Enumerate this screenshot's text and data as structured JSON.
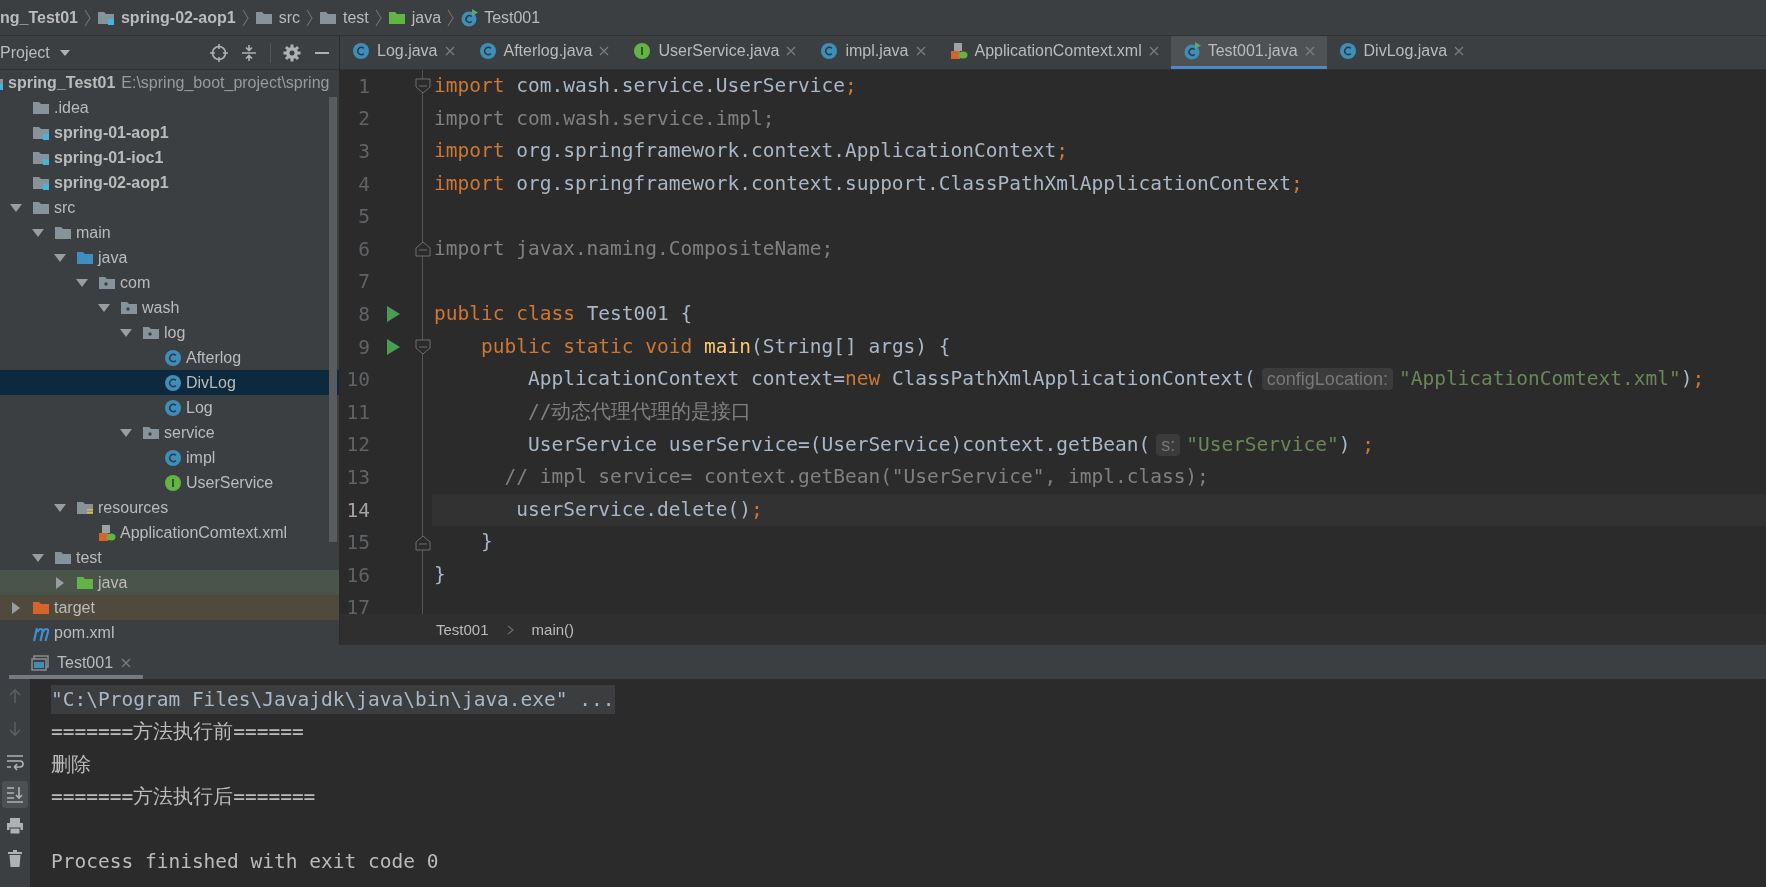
{
  "nav_bar": {
    "items": [
      {
        "kind": "project",
        "text": "ng_Test01"
      },
      {
        "kind": "module",
        "text": "spring-02-aop1"
      },
      {
        "kind": "folder",
        "text": "src"
      },
      {
        "kind": "folder",
        "text": "test"
      },
      {
        "kind": "test-source",
        "text": "java"
      },
      {
        "kind": "class-run",
        "text": "Test001"
      }
    ]
  },
  "project_panel": {
    "title": "Project",
    "tree": [
      {
        "name": "spring_Test01",
        "kind": "module",
        "path": "E:\\spring_boot_project\\spring",
        "selected": false,
        "children": [
          {
            "name": ".idea",
            "kind": "folder",
            "selected": false
          },
          {
            "name": "spring-01-aop1",
            "kind": "module",
            "selected": false
          },
          {
            "name": "spring-01-ioc1",
            "kind": "module",
            "selected": false
          },
          {
            "name": "spring-02-aop1",
            "kind": "module",
            "selected": false
          },
          {
            "name": "src",
            "kind": "folder",
            "expanded": true,
            "selected": false,
            "children": [
              {
                "name": "main",
                "kind": "folder",
                "expanded": true,
                "selected": false,
                "children": [
                  {
                    "name": "java",
                    "kind": "source",
                    "expanded": true,
                    "selected": false,
                    "children": [
                      {
                        "name": "com",
                        "kind": "package",
                        "expanded": true,
                        "selected": false,
                        "children": [
                          {
                            "name": "wash",
                            "kind": "package",
                            "expanded": true,
                            "selected": false,
                            "children": [
                              {
                                "name": "log",
                                "kind": "package",
                                "expanded": true,
                                "selected": false,
                                "children": [
                                  {
                                    "name": "Afterlog",
                                    "kind": "class",
                                    "selected": false
                                  },
                                  {
                                    "name": "DivLog",
                                    "kind": "class",
                                    "selected": true
                                  },
                                  {
                                    "name": "Log",
                                    "kind": "class",
                                    "selected": false
                                  }
                                ]
                              },
                              {
                                "name": "service",
                                "kind": "package",
                                "expanded": true,
                                "selected": false,
                                "children": [
                                  {
                                    "name": "impl",
                                    "kind": "class",
                                    "selected": false
                                  },
                                  {
                                    "name": "UserService",
                                    "kind": "interface",
                                    "selected": false
                                  }
                                ]
                              }
                            ]
                          }
                        ]
                      }
                    ]
                  },
                  {
                    "name": "resources",
                    "kind": "resources",
                    "expanded": true,
                    "selected": false,
                    "children": [
                      {
                        "name": "ApplicationComtext.xml",
                        "kind": "xml",
                        "selected": false
                      }
                    ]
                  }
                ]
              },
              {
                "name": "test",
                "kind": "folder",
                "expanded": true,
                "selected": false,
                "children": [
                  {
                    "name": "java",
                    "kind": "test-source",
                    "expanded": false,
                    "selected": false
                  }
                ]
              }
            ]
          },
          {
            "name": "target",
            "kind": "excluded",
            "expanded": false,
            "selected": false
          },
          {
            "name": "pom.xml",
            "kind": "maven",
            "selected": false
          }
        ]
      }
    ]
  },
  "editor": {
    "tabs": [
      {
        "label": "Log.java",
        "kind": "class",
        "selected": false
      },
      {
        "label": "Afterlog.java",
        "kind": "class",
        "selected": false
      },
      {
        "label": "UserService.java",
        "kind": "interface",
        "selected": false
      },
      {
        "label": "impl.java",
        "kind": "class",
        "selected": false
      },
      {
        "label": "ApplicationComtext.xml",
        "kind": "xml",
        "selected": false
      },
      {
        "label": "Test001.java",
        "kind": "class-run",
        "selected": true
      },
      {
        "label": "DivLog.java",
        "kind": "class",
        "selected": false
      }
    ],
    "lines": [
      {
        "number": "1",
        "run": false,
        "fold": {
          "kind": "start"
        },
        "current": false,
        "tokens": [
          {
            "kind": "keyword",
            "text": "import"
          },
          {
            "kind": "plain",
            "text": " com.wash.service.UserService"
          },
          {
            "kind": "semicolon",
            "text": ";"
          }
        ]
      },
      {
        "number": "2",
        "run": false,
        "current": false,
        "tokens": [
          {
            "kind": "unused",
            "text": "import com.wash.service.impl;"
          }
        ]
      },
      {
        "number": "3",
        "run": false,
        "current": false,
        "tokens": [
          {
            "kind": "keyword",
            "text": "import"
          },
          {
            "kind": "plain",
            "text": " org.springframework.context.ApplicationContext"
          },
          {
            "kind": "semicolon",
            "text": ";"
          }
        ]
      },
      {
        "number": "4",
        "run": false,
        "current": false,
        "tokens": [
          {
            "kind": "keyword",
            "text": "import"
          },
          {
            "kind": "plain",
            "text": " org.springframework.context.support.ClassPathXmlApplicationContext"
          },
          {
            "kind": "semicolon",
            "text": ";"
          }
        ]
      },
      {
        "number": "5",
        "run": false,
        "current": false
      },
      {
        "number": "6",
        "run": false,
        "fold": {
          "kind": "end"
        },
        "current": false,
        "tokens": [
          {
            "kind": "unused",
            "text": "import javax.naming.CompositeName;"
          }
        ]
      },
      {
        "number": "7",
        "run": false,
        "current": false
      },
      {
        "number": "8",
        "run": true,
        "current": false,
        "tokens": [
          {
            "kind": "keyword",
            "text": "public class"
          },
          {
            "kind": "plain",
            "text": " Test001 {"
          }
        ]
      },
      {
        "number": "9",
        "run": true,
        "fold": {
          "kind": "start"
        },
        "current": false,
        "tokens": [
          {
            "kind": "keyword",
            "text": "    public static void "
          },
          {
            "kind": "method",
            "text": "main"
          },
          {
            "kind": "plain",
            "text": "(String[] args) {"
          }
        ]
      },
      {
        "number": "10",
        "run": false,
        "current": false,
        "tokens": [
          {
            "kind": "plain",
            "text": "        ApplicationContext context="
          },
          {
            "kind": "keyword",
            "text": "new"
          },
          {
            "kind": "plain",
            "text": " ClassPathXmlApplicationContext("
          },
          {
            "kind": "hint",
            "text": "configLocation:"
          },
          {
            "kind": "string",
            "text": "\"ApplicationComtext.xml\""
          },
          {
            "kind": "plain",
            "text": ")"
          },
          {
            "kind": "semicolon",
            "text": ";"
          }
        ]
      },
      {
        "number": "11",
        "run": false,
        "current": false,
        "tokens": [
          {
            "kind": "comment",
            "text": "        //动态代理代理的是接口"
          }
        ]
      },
      {
        "number": "12",
        "run": false,
        "current": false,
        "tokens": [
          {
            "kind": "plain",
            "text": "        UserService userService=(UserService)context.getBean("
          },
          {
            "kind": "hint",
            "text": "s:"
          },
          {
            "kind": "string",
            "text": "\"UserService\""
          },
          {
            "kind": "plain",
            "text": ") "
          },
          {
            "kind": "semicolon",
            "text": ";"
          }
        ]
      },
      {
        "number": "13",
        "run": false,
        "current": false,
        "tokens": [
          {
            "kind": "comment",
            "text": "      // impl service= context.getBean(\"UserService\", impl.class);"
          }
        ]
      },
      {
        "number": "14",
        "run": false,
        "current": true,
        "tokens": [
          {
            "kind": "plain",
            "text": "       userService.delete()"
          },
          {
            "kind": "semicolon",
            "text": ";"
          }
        ]
      },
      {
        "number": "15",
        "run": false,
        "fold": {
          "kind": "end"
        },
        "current": false,
        "tokens": [
          {
            "kind": "plain",
            "text": "    }"
          }
        ]
      },
      {
        "number": "16",
        "run": false,
        "current": false,
        "tokens": [
          {
            "kind": "plain",
            "text": "}"
          }
        ]
      },
      {
        "number": "17",
        "run": false,
        "current": false
      }
    ],
    "breadcrumb": [
      "Test001",
      "main()"
    ]
  },
  "run_panel": {
    "tab": {
      "label": "Test001",
      "selected": true
    },
    "toolbar": [
      {
        "kind": "up",
        "disabled": true,
        "selected": false
      },
      {
        "kind": "down",
        "disabled": true,
        "selected": false
      },
      {
        "kind": "soft-wrap",
        "disabled": false,
        "selected": false
      },
      {
        "kind": "scroll-to-end",
        "disabled": false,
        "selected": true
      },
      {
        "kind": "print",
        "disabled": false,
        "selected": false
      },
      {
        "kind": "delete",
        "disabled": false,
        "selected": false
      }
    ],
    "lines": [
      {
        "kind": "command",
        "text": "\"C:\\Program Files\\Javajdk\\java\\bin\\java.exe\" ..."
      },
      {
        "kind": "output",
        "text": "=======方法执行前======"
      },
      {
        "kind": "output",
        "text": "删除"
      },
      {
        "kind": "output",
        "text": "=======方法执行后======="
      },
      {
        "kind": "exit",
        "text": "Process finished with exit code 0"
      }
    ]
  }
}
